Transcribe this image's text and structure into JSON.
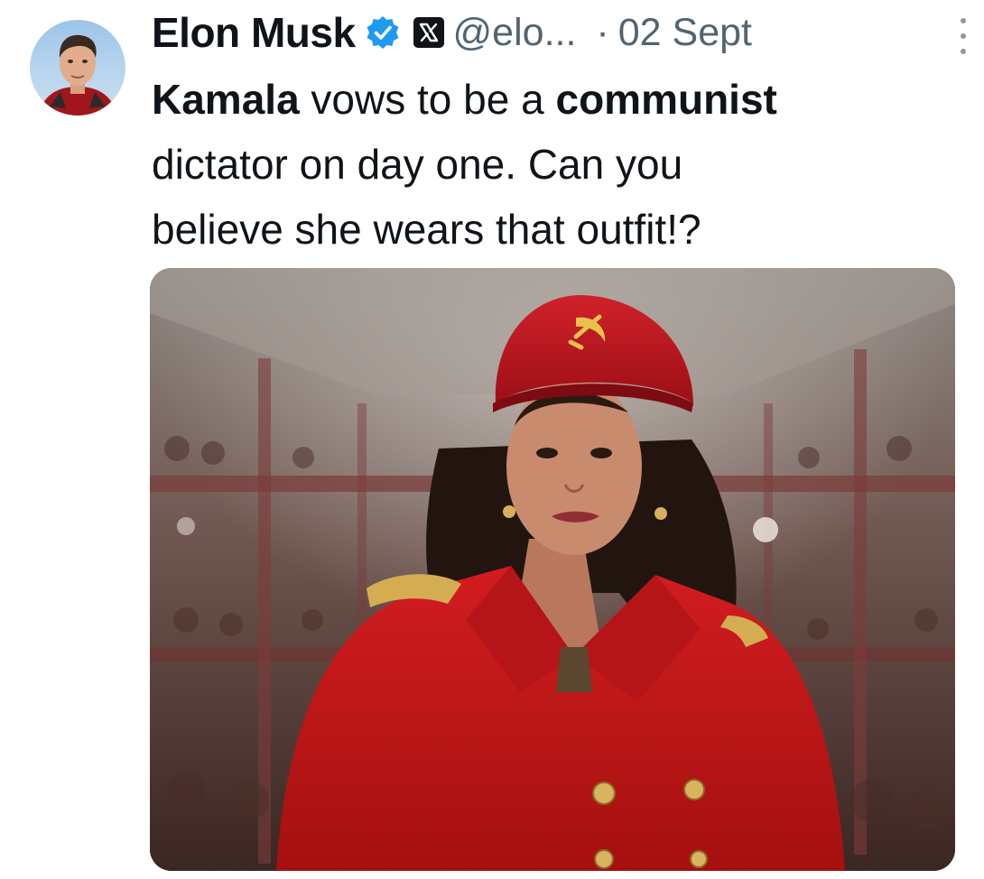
{
  "post": {
    "author": {
      "display_name": "Elon Musk",
      "handle": "@elo...",
      "verified_icon": "verified-badge-icon",
      "platform_icon": "x-logo-icon"
    },
    "separator": "·",
    "timestamp": "02 Sept",
    "menu_icon": "more-vertical-icon",
    "text": {
      "line1_bold1": "Kamala",
      "line1_plain": " vows to be a ",
      "line1_bold2": "communist",
      "line2": "dictator on day one. Can you",
      "line3": "believe she wears that outfit!?"
    },
    "media": {
      "type": "image"
    }
  },
  "colors": {
    "text_primary": "#0f1419",
    "text_secondary": "#536471",
    "verified_blue": "#1d9bf0",
    "coat_red": "#c8191c"
  }
}
